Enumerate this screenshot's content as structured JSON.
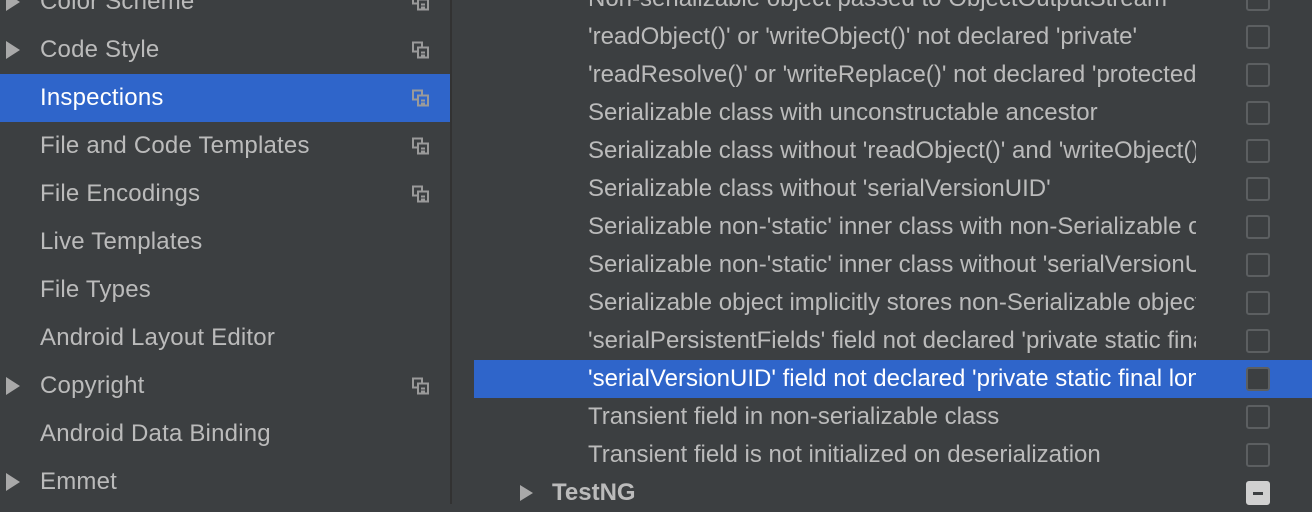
{
  "sidebar": {
    "items": [
      {
        "label": "Color Scheme",
        "arrow": true,
        "copy_icon": true
      },
      {
        "label": "Code Style",
        "arrow": true,
        "copy_icon": true
      },
      {
        "label": "Inspections",
        "arrow": false,
        "copy_icon": true,
        "selected": true
      },
      {
        "label": "File and Code Templates",
        "arrow": false,
        "copy_icon": true
      },
      {
        "label": "File Encodings",
        "arrow": false,
        "copy_icon": true
      },
      {
        "label": "Live Templates",
        "arrow": false,
        "copy_icon": false
      },
      {
        "label": "File Types",
        "arrow": false,
        "copy_icon": false
      },
      {
        "label": "Android Layout Editor",
        "arrow": false,
        "copy_icon": false
      },
      {
        "label": "Copyright",
        "arrow": true,
        "copy_icon": true
      },
      {
        "label": "Android Data Binding",
        "arrow": false,
        "copy_icon": false
      },
      {
        "label": "Emmet",
        "arrow": true,
        "copy_icon": false
      }
    ]
  },
  "inspections": {
    "rows": [
      {
        "label": "Non-serializable object passed to ObjectOutputStream",
        "checked": false
      },
      {
        "label": "'readObject()' or 'writeObject()' not declared 'private'",
        "checked": false
      },
      {
        "label": "'readResolve()' or 'writeReplace()' not declared 'protected'",
        "checked": false
      },
      {
        "label": "Serializable class with unconstructable ancestor",
        "checked": false
      },
      {
        "label": "Serializable class without 'readObject()' and 'writeObject()'",
        "checked": false
      },
      {
        "label": "Serializable class without 'serialVersionUID'",
        "checked": false
      },
      {
        "label": "Serializable non-'static' inner class with non-Serializable outer class",
        "checked": false
      },
      {
        "label": "Serializable non-'static' inner class without 'serialVersionUID'",
        "checked": false
      },
      {
        "label": "Serializable object implicitly stores non-Serializable object",
        "checked": false
      },
      {
        "label": "'serialPersistentFields' field not declared 'private static final'",
        "checked": false
      },
      {
        "label": "'serialVersionUID' field not declared 'private static final long'",
        "checked": false,
        "selected": true
      },
      {
        "label": "Transient field in non-serializable class",
        "checked": false
      },
      {
        "label": "Transient field is not initialized on deserialization",
        "checked": false
      }
    ],
    "group": {
      "label": "TestNG",
      "state": "partial"
    }
  },
  "colors": {
    "background": "#3c3f41",
    "selection": "#2f65ca",
    "text": "#bbbbbb"
  }
}
